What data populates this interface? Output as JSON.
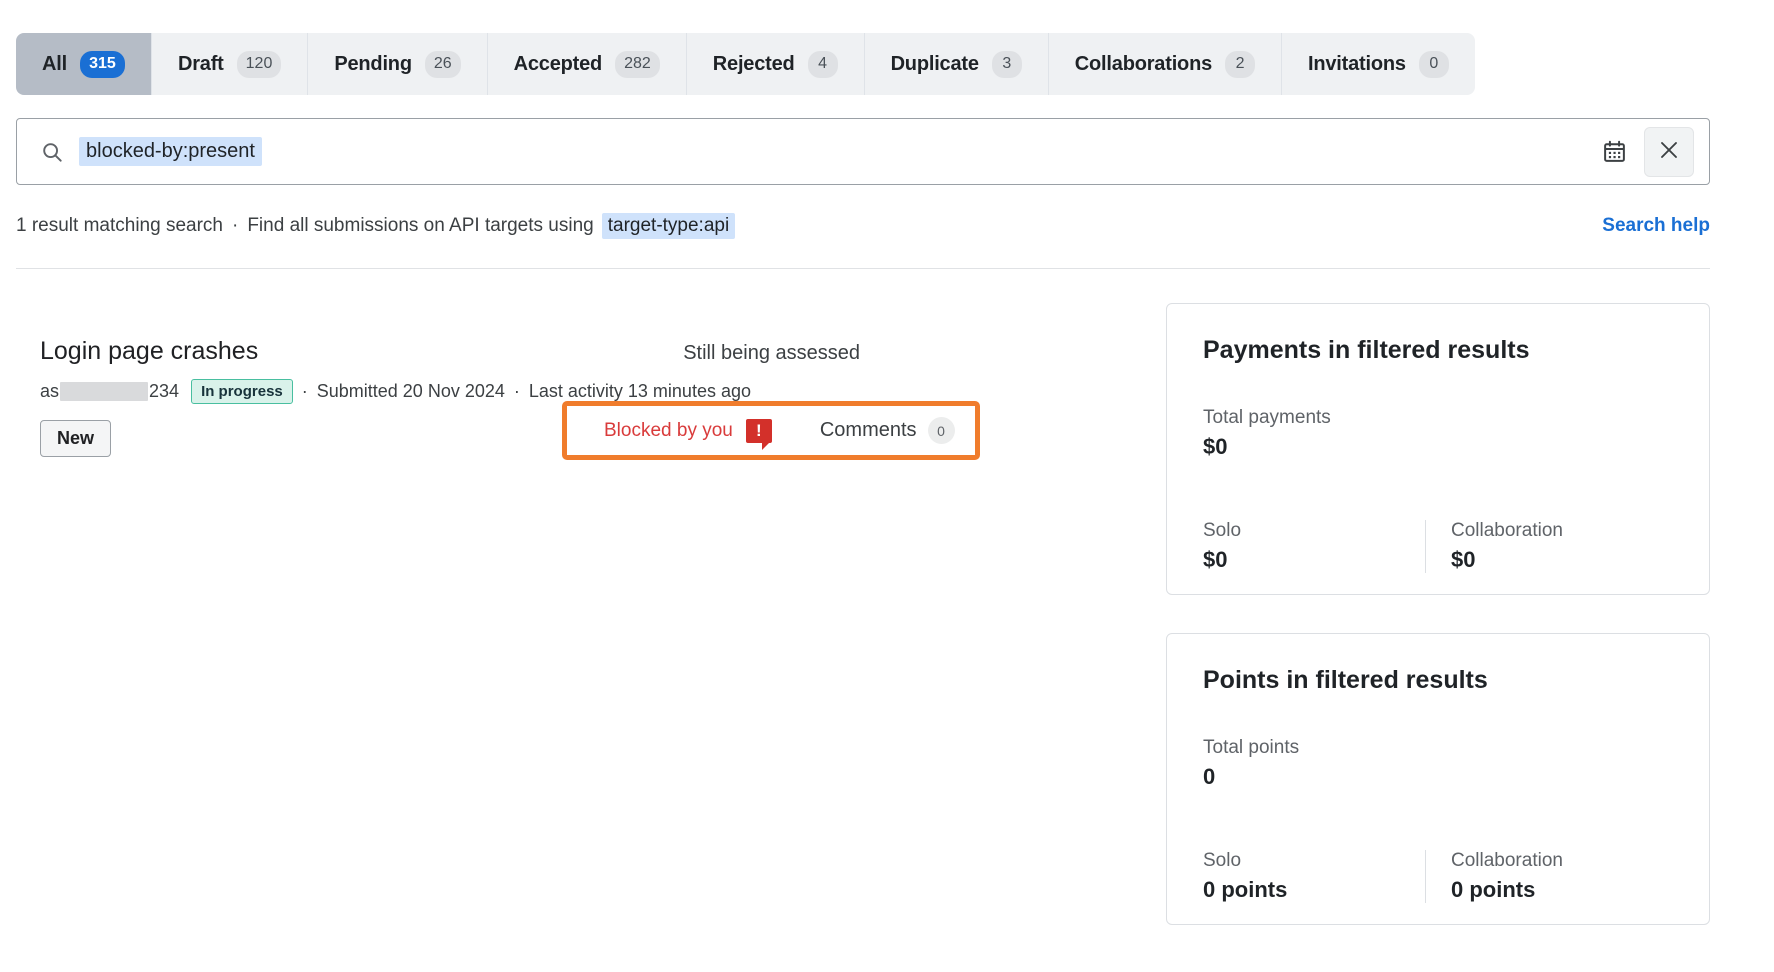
{
  "tabs": [
    {
      "label": "All",
      "count": "315",
      "active": true
    },
    {
      "label": "Draft",
      "count": "120",
      "active": false
    },
    {
      "label": "Pending",
      "count": "26",
      "active": false
    },
    {
      "label": "Accepted",
      "count": "282",
      "active": false
    },
    {
      "label": "Rejected",
      "count": "4",
      "active": false
    },
    {
      "label": "Duplicate",
      "count": "3",
      "active": false
    },
    {
      "label": "Collaborations",
      "count": "2",
      "active": false
    },
    {
      "label": "Invitations",
      "count": "0",
      "active": false
    }
  ],
  "search": {
    "icon": "search-icon",
    "query_token": "blocked-by:present",
    "calendar_icon": "calendar-icon",
    "clear_icon": "close-icon"
  },
  "results_meta": {
    "count_text": "1 result matching search",
    "separator": "·",
    "hint_text": "Find all submissions on API targets using",
    "hint_token": "target-type:api",
    "search_help": "Search help"
  },
  "submission": {
    "title": "Login page crashes",
    "assessment_state": "Still being assessed",
    "handle_prefix": "as",
    "handle_suffix": "234",
    "status_badge": "In progress",
    "submitted": "Submitted 20 Nov 2024",
    "last_activity": "Last activity 13 minutes ago",
    "new_button": "New",
    "blocked_label": "Blocked by you",
    "blocked_icon": "alert-bubble-icon",
    "comments_label": "Comments",
    "comments_count": "0"
  },
  "cards": [
    {
      "title": "Payments in filtered results",
      "total_label": "Total payments",
      "total_value": "$0",
      "solo_label": "Solo",
      "solo_value": "$0",
      "collab_label": "Collaboration",
      "collab_value": "$0"
    },
    {
      "title": "Points in filtered results",
      "total_label": "Total points",
      "total_value": "0",
      "solo_label": "Solo",
      "solo_value": "0 points",
      "collab_label": "Collaboration",
      "collab_value": "0 points"
    }
  ],
  "colors": {
    "accent_blue": "#1a6fd4",
    "highlight_orange": "#f07c2c",
    "blocked_red": "#d93b3b",
    "bubble_red": "#d3302a",
    "inprogress_border": "#49bfa0",
    "token_blue_bg": "#cfe2fb",
    "active_tab_bg": "#b5bcc6"
  }
}
